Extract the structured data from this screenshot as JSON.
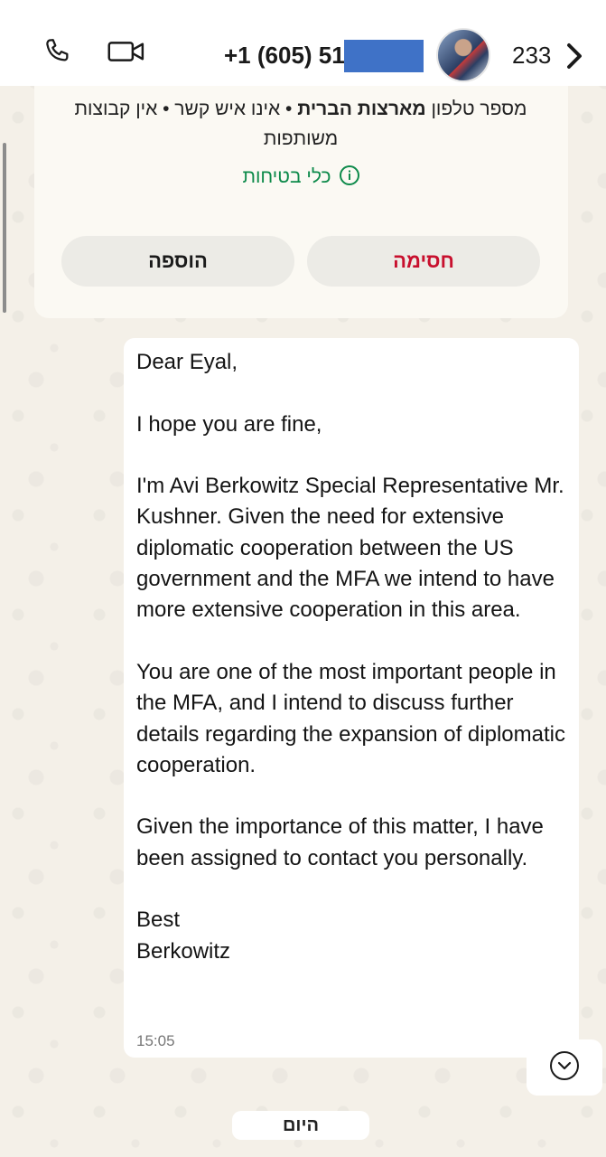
{
  "header": {
    "phone_number": "+1 (605) 51",
    "count": "233",
    "icons": [
      "phone-icon",
      "video-icon",
      "chevron-right-icon"
    ]
  },
  "info_card": {
    "line_prefix": "מספר טלפון ",
    "country": "מארצות הברית",
    "line_suffix": " • אינו איש קשר • אין קבוצות משותפות",
    "safety_label": "כלי בטיחות",
    "add_label": "הוספה",
    "block_label": "חסימה",
    "block_color": "#c8102e",
    "safety_color": "#0d8a4a"
  },
  "message": {
    "paragraphs": [
      "Dear Eyal,",
      "I hope you are fine,",
      "I'm Avi Berkowitz Special Representative Mr. Kushner. Given the need for extensive diplomatic cooperation between the US government and the MFA we intend to have more extensive cooperation in this area.",
      "You are one of the most important people in the MFA, and I intend to discuss further details regarding the expansion of diplomatic cooperation.",
      "Given the importance of this matter, I have been assigned to contact you personally."
    ],
    "closing": "Best",
    "signature": "Berkowitz",
    "time": "15:05"
  },
  "date_divider": "היום"
}
